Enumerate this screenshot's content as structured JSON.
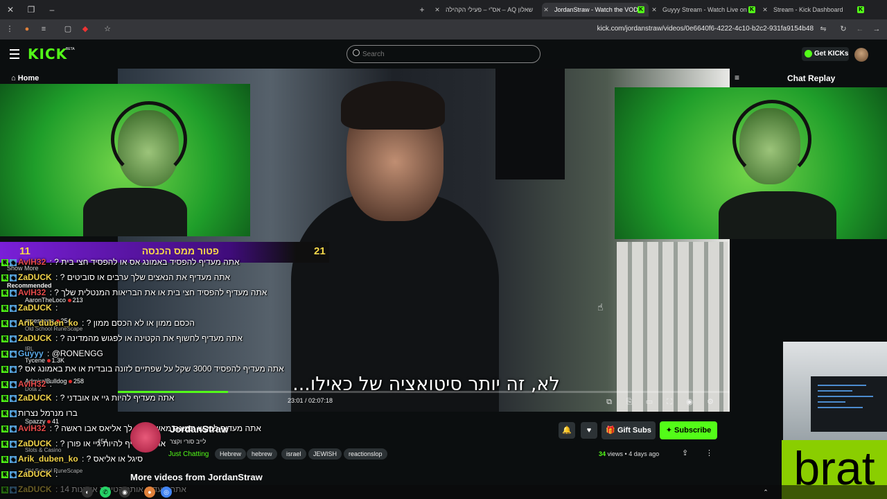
{
  "browser": {
    "tabs": [
      {
        "title": "שאלון AQ – אס\"י – פעילי הקהילה",
        "active": false
      },
      {
        "title": "JordanStraw - Watch the VOD o",
        "active": true
      },
      {
        "title": "Guyyy Stream - Watch Live on K",
        "active": false
      },
      {
        "title": "Stream - Kick Dashboard",
        "active": false
      }
    ],
    "url": "kick.com/jordanstraw/videos/0e6640f6-4222-4c10-b2c2-931fa9154b48"
  },
  "header": {
    "logo": "KICK",
    "beta": "BETA",
    "search_placeholder": "Search",
    "get_kicks": "Get KICKs"
  },
  "nav": {
    "home": "Home"
  },
  "chat_panel": {
    "title": "Chat Replay"
  },
  "goal_banner": {
    "left_count": "11",
    "text": "פטור ממס הכנסה",
    "right_count": "21"
  },
  "chat": [
    {
      "user": "AvIH32",
      "color": "#e44a4a",
      "msg": "אתה מעדיף להפסיד באמונג אס או להפסיד חצי בית ?"
    },
    {
      "user": "ZaDUCK",
      "color": "#f2d44a",
      "msg": "אתה מעדיף את הנאצים שלך ערבים או סוביטים ?"
    },
    {
      "user": "AvIH32",
      "color": "#e44a4a",
      "msg": "אתה מעדיף להפסיד חצי בית או את הבריאות המנטלית שלך ?"
    },
    {
      "user": "ZaDUCK",
      "color": "#f2d44a",
      "msg": ""
    },
    {
      "user": "Arik_duben_ko",
      "color": "#f2d44a",
      "msg": "הכסם ממון או לא הכסם ממון ?"
    },
    {
      "user": "ZaDUCK",
      "color": "#f2d44a",
      "msg": "אתה מעדיף לחשוף את הקטינה או לפגוש מהמדינה ?"
    },
    {
      "user": "Guyyy",
      "color": "#5aa9e6",
      "msg": "@RONENGG"
    },
    {
      "user": "",
      "color": "#fff",
      "msg": "אתה מעדיף להפסיד 3000 שקל על שפתיים לזונה בובדית או את באמונג אס ?"
    },
    {
      "user": "AvIH32",
      "color": "#e44a4a",
      "msg": ""
    },
    {
      "user": "ZaDUCK",
      "color": "#f2d44a",
      "msg": "אתה מעדיף להיות גיי או אובדני ?"
    },
    {
      "user": "",
      "color": "#fff",
      "msg": "ברו מנרמל נצרות"
    },
    {
      "user": "AvIH32",
      "color": "#e44a4a",
      "msg": "אתה מעדיף לבקש תמונה מאשתך או לך אליאס אבו ראשה ?"
    },
    {
      "user": "ZaDUCK",
      "color": "#f2d44a",
      "msg": "אתה מעדיף להיות גיי או פורן ?"
    },
    {
      "user": "Arik_duben_ko",
      "color": "#f2d44a",
      "msg": "סיגל או אליאס ?"
    },
    {
      "user": "ZaDUCK",
      "color": "#f2d44a",
      "msg": ""
    },
    {
      "user": "ZaDUCK",
      "color": "#f2d44a",
      "msg": "אתה מעדיף אותך קטינות או בנות 14"
    }
  ],
  "sidebar": {
    "show_more": "Show More",
    "recommended": "Recommended",
    "channels": [
      {
        "name": "AaronTheLoco",
        "sub": "",
        "viewers": "213"
      },
      {
        "name": "arcesgone",
        "sub": "Old School RuneScape",
        "viewers": "254"
      },
      {
        "name": "",
        "sub": "IRL",
        "viewers": ""
      },
      {
        "name": "Tycene",
        "sub": "",
        "viewers": "1.3K"
      },
      {
        "name": "AdmiralBulldog",
        "sub": "Dota 2",
        "viewers": "258"
      },
      {
        "name": "Spazzy",
        "sub": "",
        "viewers": "41"
      },
      {
        "name": "",
        "sub": "Slots & Casino",
        "viewers": "454"
      },
      {
        "name": "",
        "sub": "Old School RuneScape",
        "viewers": ""
      }
    ]
  },
  "video": {
    "subtitle": "לא, זה יותר סיטואציה של כאילו...",
    "time": "23:01 / 02:07:18",
    "progress_fraction": 0.18
  },
  "channel": {
    "name": "JordanStraw",
    "title": "לייב סורי וקצר",
    "category": "Just Chatting",
    "tags": [
      "Hebrew",
      "hebrew",
      "israel",
      "JEWISH",
      "reactionslop"
    ],
    "views_count": "34",
    "views_label": "views",
    "age": "4 days ago",
    "gift_subs": "Gift Subs",
    "subscribe": "Subscribe",
    "more_videos": "More videos from JordanStraw"
  },
  "overlay": {
    "brat": "brat",
    "brat_color": "#8ace00"
  },
  "colors": {
    "kick_green": "#53fc18",
    "bg": "#0b0e0f"
  }
}
